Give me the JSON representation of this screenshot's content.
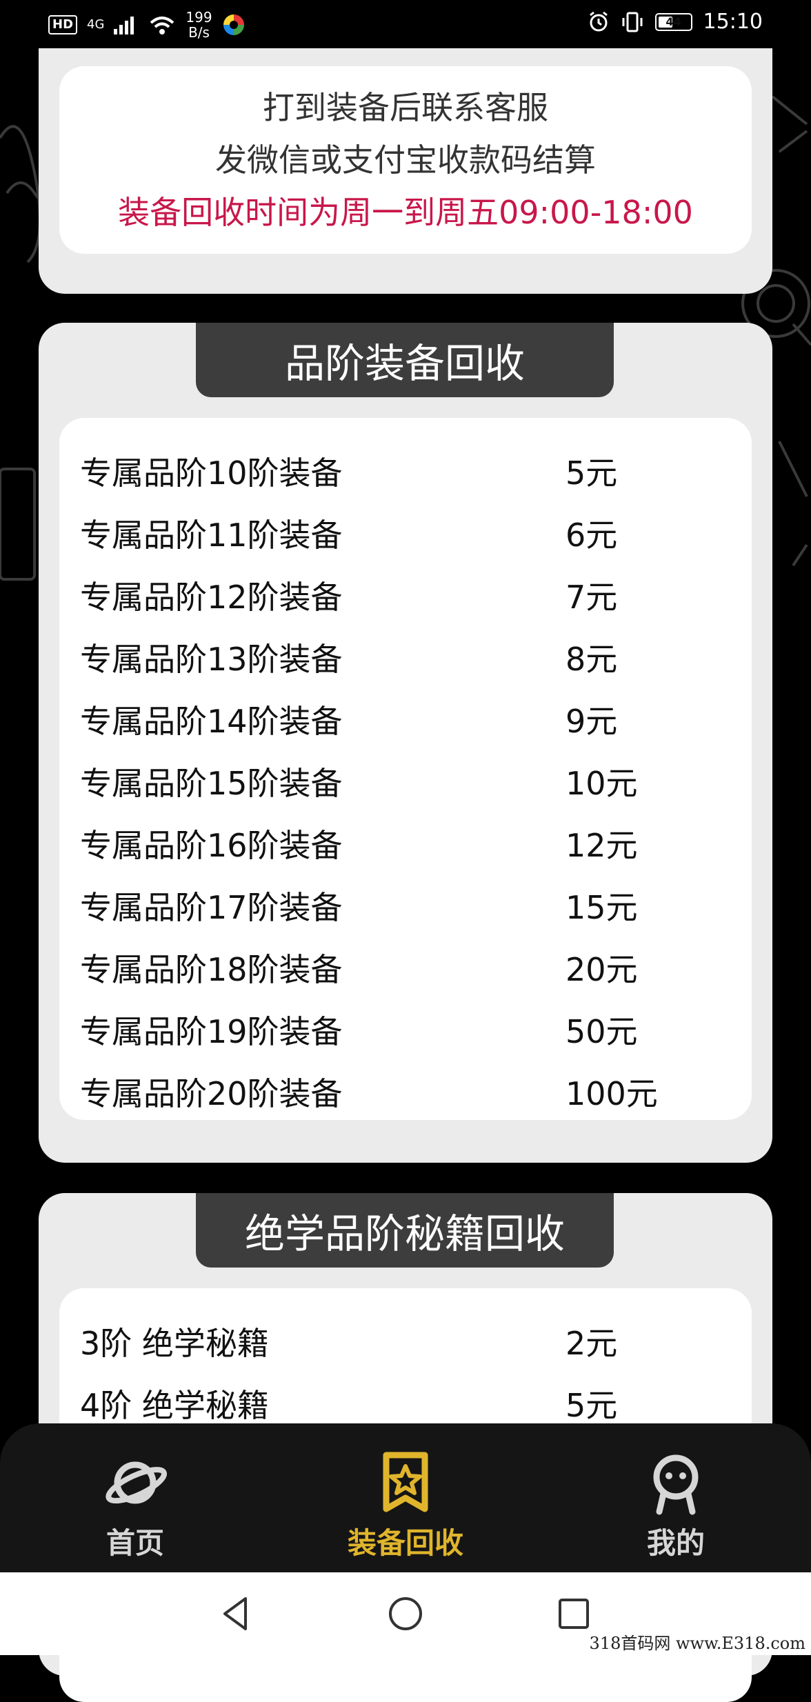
{
  "status_bar": {
    "hd": "HD",
    "network": "4G",
    "speed_value": "199",
    "speed_unit": "B/s",
    "battery": "44",
    "time": "15:10"
  },
  "notice": {
    "line1": "打到装备后联系客服",
    "line2": "发微信或支付宝收款码结算",
    "line3": "装备回收时间为周一到周五09:00-18:00"
  },
  "equipment_section": {
    "title": "品阶装备回收",
    "rows": [
      {
        "name": "专属品阶10阶装备",
        "price": "5元"
      },
      {
        "name": "专属品阶11阶装备",
        "price": "6元"
      },
      {
        "name": "专属品阶12阶装备",
        "price": "7元"
      },
      {
        "name": "专属品阶13阶装备",
        "price": "8元"
      },
      {
        "name": "专属品阶14阶装备",
        "price": "9元"
      },
      {
        "name": "专属品阶15阶装备",
        "price": "10元"
      },
      {
        "name": "专属品阶16阶装备",
        "price": "12元"
      },
      {
        "name": "专属品阶17阶装备",
        "price": "15元"
      },
      {
        "name": "专属品阶18阶装备",
        "price": "20元"
      },
      {
        "name": "专属品阶19阶装备",
        "price": "50元"
      },
      {
        "name": "专属品阶20阶装备",
        "price": "100元"
      }
    ]
  },
  "manual_section": {
    "title": "绝学品阶秘籍回收",
    "rows": [
      {
        "name": "3阶 绝学秘籍",
        "price": "2元"
      },
      {
        "name": "4阶 绝学秘籍",
        "price": "5元"
      }
    ]
  },
  "tabs": [
    {
      "label": "首页",
      "icon": "planet-icon",
      "active": false
    },
    {
      "label": "装备回收",
      "icon": "star-badge-icon",
      "active": true
    },
    {
      "label": "我的",
      "icon": "robot-profile-icon",
      "active": false
    }
  ],
  "nav_bar": {
    "back_icon": "triangle-back-icon",
    "home_icon": "circle-home-icon",
    "recents_icon": "square-recents-icon"
  },
  "watermark": "318首码网 www.E318.com",
  "colors": {
    "accent_red": "#c8174a",
    "active_tab": "#e0b52c",
    "section_title_bg": "#3d3d3d",
    "card_bg": "#ebebeb"
  }
}
